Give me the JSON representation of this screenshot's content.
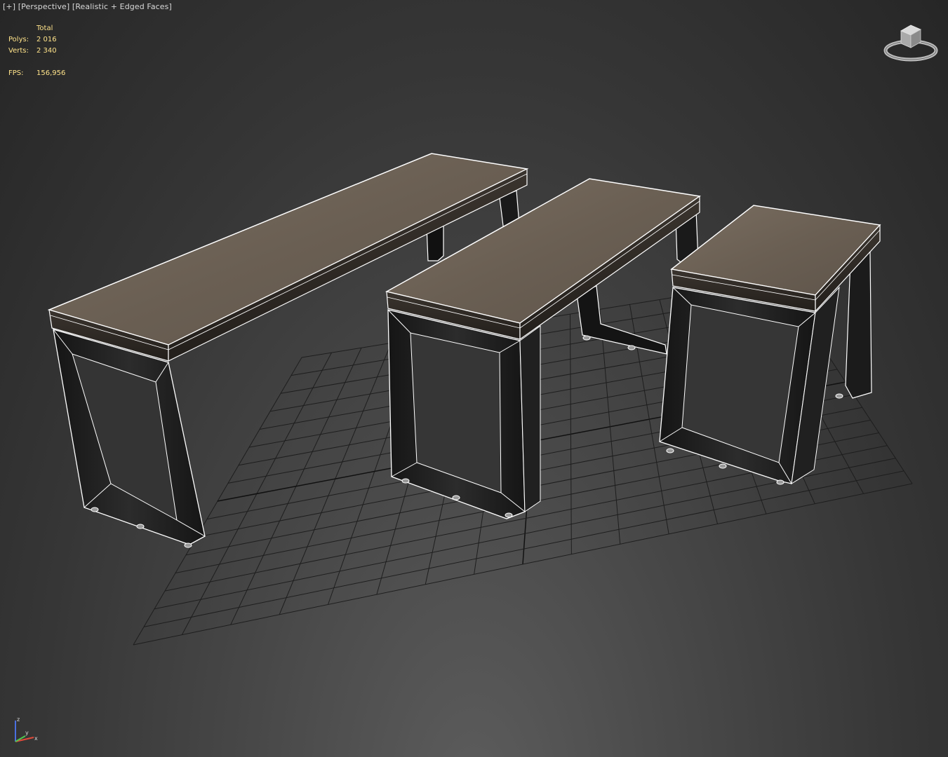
{
  "viewport": {
    "plus_label": "[+]",
    "view_label": "[Perspective]",
    "shading_label": "[Realistic + Edged Faces]"
  },
  "stats": {
    "header": "Total",
    "polys_label": "Polys:",
    "polys_value": "2 016",
    "verts_label": "Verts:",
    "verts_value": "2 340",
    "fps_label": "FPS:",
    "fps_value": "156,956"
  },
  "axis": {
    "x": "x",
    "y": "y",
    "z": "z"
  },
  "icons": {
    "viewcube": "viewcube-icon",
    "axis_tripod": "axis-tripod-icon"
  },
  "colors": {
    "stats_text": "#ffe38a",
    "label_text": "#d8d8d8",
    "wireframe": "#ffffff",
    "wood_top": "#6f6457",
    "metal_frame": "#1e1e1e",
    "grid": "#1a1a1a",
    "axis_x": "#e04a3a",
    "axis_y": "#4ec94e",
    "axis_z": "#4a6fe0"
  }
}
